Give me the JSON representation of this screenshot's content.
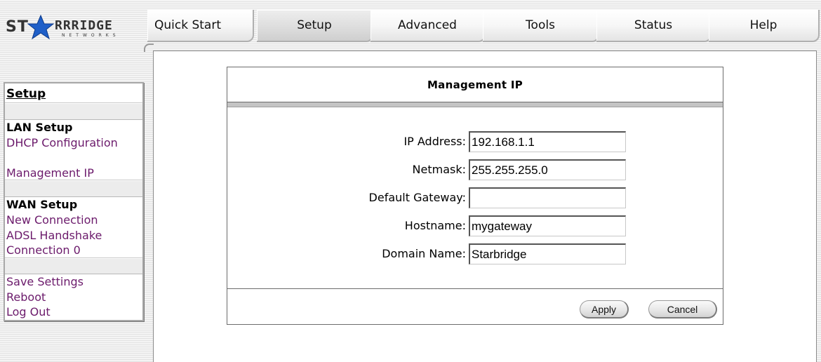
{
  "brand": {
    "logo_text_left": "ST",
    "logo_text_right": "RRRIDGE",
    "logo_subtext": "NETWORKS",
    "star_color": "#1f5fc8"
  },
  "tabs": [
    {
      "label": "Quick Start",
      "active": false
    },
    {
      "label": "Setup",
      "active": true
    },
    {
      "label": "Advanced",
      "active": false
    },
    {
      "label": "Tools",
      "active": false
    },
    {
      "label": "Status",
      "active": false
    },
    {
      "label": "Help",
      "active": false
    }
  ],
  "sidebar": {
    "title": "Setup",
    "lan_heading": "LAN Setup",
    "lan_items": [
      "DHCP Configuration",
      "Management IP"
    ],
    "wan_heading": "WAN Setup",
    "wan_items": [
      "New Connection",
      "ADSL Handshake",
      "Connection 0"
    ],
    "footer_items": [
      "Save Settings",
      "Reboot",
      "Log Out"
    ],
    "link_color": "#6b1a6b"
  },
  "panel": {
    "title": "Management IP",
    "fields": [
      {
        "label": "IP Address:",
        "value": "192.168.1.1"
      },
      {
        "label": "Netmask:",
        "value": "255.255.255.0"
      },
      {
        "label": "Default Gateway:",
        "value": ""
      },
      {
        "label": "Hostname:",
        "value": "mygateway"
      },
      {
        "label": "Domain Name:",
        "value": "Starbridge"
      }
    ],
    "apply_label": "Apply",
    "cancel_label": "Cancel"
  }
}
